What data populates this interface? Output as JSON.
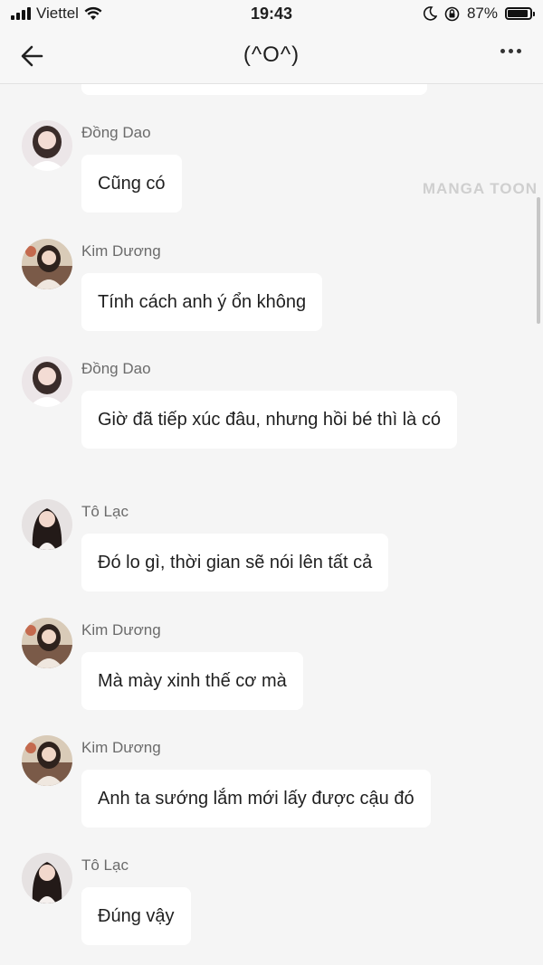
{
  "status_bar": {
    "carrier": "Viettel",
    "time": "19:43",
    "battery": "87%"
  },
  "header": {
    "title": "(^O^)"
  },
  "watermark": "MANGA TOON",
  "messages": [
    {
      "sender": "Đồng Dao",
      "text": "Cũng có",
      "avatar": "dong-dao-avatar"
    },
    {
      "sender": "Kim Dương",
      "text": "Tính cách anh ý ổn không",
      "avatar": "kim-duong-avatar"
    },
    {
      "sender": "Đồng Dao",
      "text": "Giờ đã tiếp xúc đâu, nhưng hồi bé thì là có",
      "avatar": "dong-dao-avatar"
    },
    {
      "sender": "Tô Lạc",
      "text": "Đó lo gì, thời gian sẽ nói lên tất cả",
      "avatar": "to-lac-avatar"
    },
    {
      "sender": "Kim Dương",
      "text": "Mà mày xinh thế cơ mà",
      "avatar": "kim-duong-avatar"
    },
    {
      "sender": "Kim Dương",
      "text": "Anh ta sướng lắm mới lấy được cậu đó",
      "avatar": "kim-duong-avatar"
    },
    {
      "sender": "Tô Lạc",
      "text": "Đúng vậy",
      "avatar": "to-lac-avatar"
    }
  ],
  "colors": {
    "background": "#f5f5f5",
    "bubble": "#ffffff",
    "sender_text": "#6b6b6b"
  }
}
